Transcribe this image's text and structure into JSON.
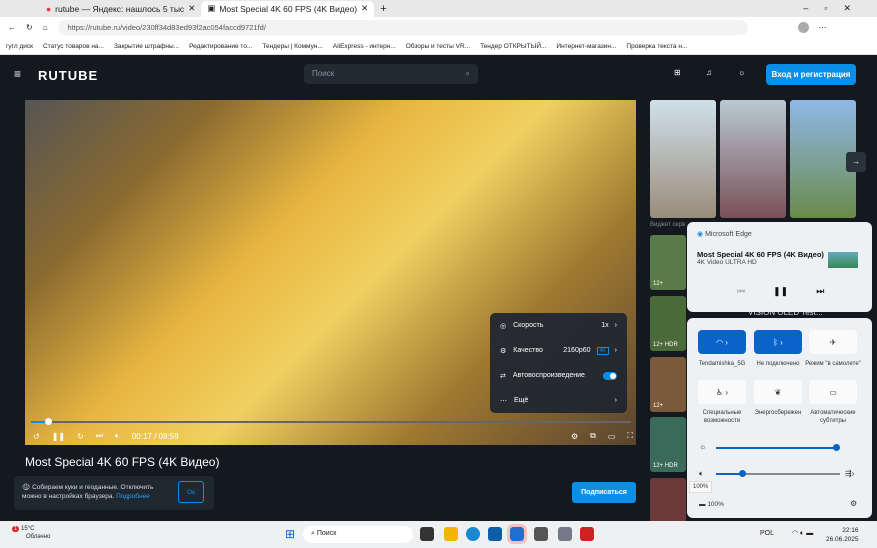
{
  "browser": {
    "tabs": [
      {
        "label": "rutube — Яндекс: нашлось 5 тыс"
      },
      {
        "label": "Most Special 4K 60 FPS (4K Видео)"
      }
    ],
    "url": "https://rutube.ru/video/230ff34d83ed93f2ac054faccd9721fd/",
    "bookmarks": [
      "гугл диск",
      "Статус товаров на...",
      "Закрытие штрафны...",
      "Редактирование то...",
      "Тендеры | Коммун...",
      "AliExpress - интерн...",
      "Обзоры и тесты VR...",
      "Тендер ОТКРЫТЫЙ...",
      "Интернет-магазин...",
      "Проверка текста н..."
    ]
  },
  "site": {
    "logo": "RUTUBE",
    "search_placeholder": "Поиск",
    "login": "Вход и регистрация"
  },
  "player": {
    "time": "00:17 / 09:59",
    "progress": 0.03,
    "menu": [
      {
        "label": "Скорость",
        "value": "1x"
      },
      {
        "label": "Качество",
        "value": "2160p60",
        "badge": "4K"
      },
      {
        "label": "Автовоспроизведение",
        "toggle": true
      },
      {
        "label": "Ещё"
      }
    ]
  },
  "video_title": "Most Special 4K 60 FPS (4K Видео)",
  "cookie": {
    "text": "Собираем куки и геоданные. Отключить можно в настройках браузера.",
    "link": "Подробнее",
    "ok": "Ок"
  },
  "subscribe": "Подписаться",
  "sidebar": {
    "widget_label": "Виджет серв",
    "list_title_fragment": "VISION OLED Test...",
    "badges": [
      "12+",
      "12+ HDR",
      "12+",
      "12+ HDR"
    ]
  },
  "media_flyout": {
    "app": "Microsoft Edge",
    "title": "Most Special 4K 60 FPS (4K Видео)",
    "subtitle": "4K Video ULTRA HD"
  },
  "quick_settings": {
    "tiles": [
      "Tendamishka_5G",
      "Не подключено",
      "Режим \"в самолете\"",
      "Специальные возможности",
      "Энергосбережен",
      "Автоматические субтитры"
    ],
    "brightness": 0.98,
    "volume": 0.2,
    "volume_tooltip": "100%",
    "battery": "100%"
  },
  "taskbar": {
    "temp": "15°C",
    "weather": "Облачно",
    "alert": "1",
    "search": "Поиск",
    "lang": "POL",
    "time": "22:16",
    "date": "26.06.2025"
  }
}
